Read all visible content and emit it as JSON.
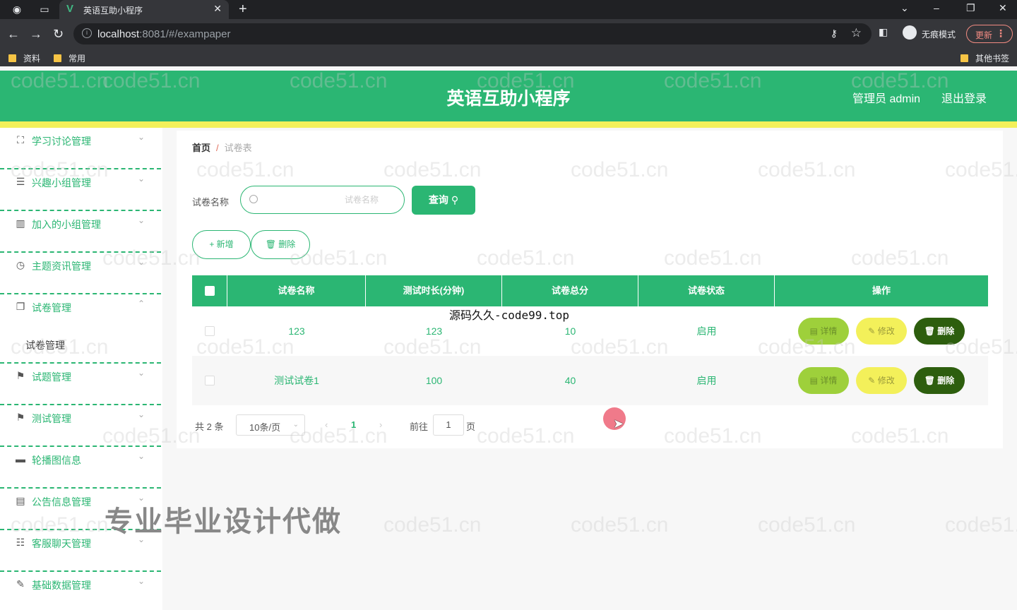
{
  "browser": {
    "tab_title": "英语互助小程序",
    "url_host": "localhost",
    "url_path": ":8081/#/exampaper",
    "incognito_label": "无痕模式",
    "update_label": "更新",
    "bookmarks": [
      "资料",
      "常用"
    ],
    "other_bookmarks": "其他书签"
  },
  "header": {
    "title": "英语互助小程序",
    "user": "管理员 admin",
    "logout": "退出登录"
  },
  "sidebar": {
    "items": [
      {
        "label": "学习讨论管理",
        "icon": "expand-icon"
      },
      {
        "label": "兴趣小组管理",
        "icon": "list-icon"
      },
      {
        "label": "加入的小组管理",
        "icon": "books-icon"
      },
      {
        "label": "主题资讯管理",
        "icon": "clock-icon"
      },
      {
        "label": "试卷管理",
        "icon": "copy-icon"
      },
      {
        "label": "试题管理",
        "icon": "flag-icon"
      },
      {
        "label": "测试管理",
        "icon": "flag-icon"
      },
      {
        "label": "轮播图信息",
        "icon": "film-icon"
      },
      {
        "label": "公告信息管理",
        "icon": "notice-icon"
      },
      {
        "label": "客服聊天管理",
        "icon": "sliders-icon"
      },
      {
        "label": "基础数据管理",
        "icon": "edit-icon"
      }
    ],
    "submenu": "试卷管理"
  },
  "breadcrumb": {
    "home": "首页",
    "separator": "/",
    "current": "试卷表"
  },
  "search": {
    "label": "试卷名称",
    "placeholder": "试卷名称",
    "button": "查询"
  },
  "actions": {
    "add": "新增",
    "delete": "删除"
  },
  "table": {
    "headers": [
      "试卷名称",
      "测试时长(分钟)",
      "试卷总分",
      "试卷状态",
      "操作"
    ],
    "rows": [
      {
        "name": "123",
        "duration": "123",
        "score": "10",
        "status": "启用"
      },
      {
        "name": "测试试卷1",
        "duration": "100",
        "score": "40",
        "status": "启用"
      }
    ],
    "ops": {
      "detail": "详情",
      "edit": "修改",
      "remove": "删除"
    }
  },
  "pagination": {
    "total": "共 2 条",
    "page_size": "10条/页",
    "current_page": "1",
    "goto_label": "前往",
    "goto_value": "1",
    "page_suffix": "页"
  },
  "overlay": {
    "source_text": "源码久久-code99.top",
    "promo": "专业毕业设计代做",
    "watermark": "code51.cn"
  },
  "colors": {
    "primary": "#2bb673",
    "accent_yellow": "#f3f05a",
    "detail_btn": "#9ed03b",
    "remove_btn": "#2d5e0e"
  }
}
